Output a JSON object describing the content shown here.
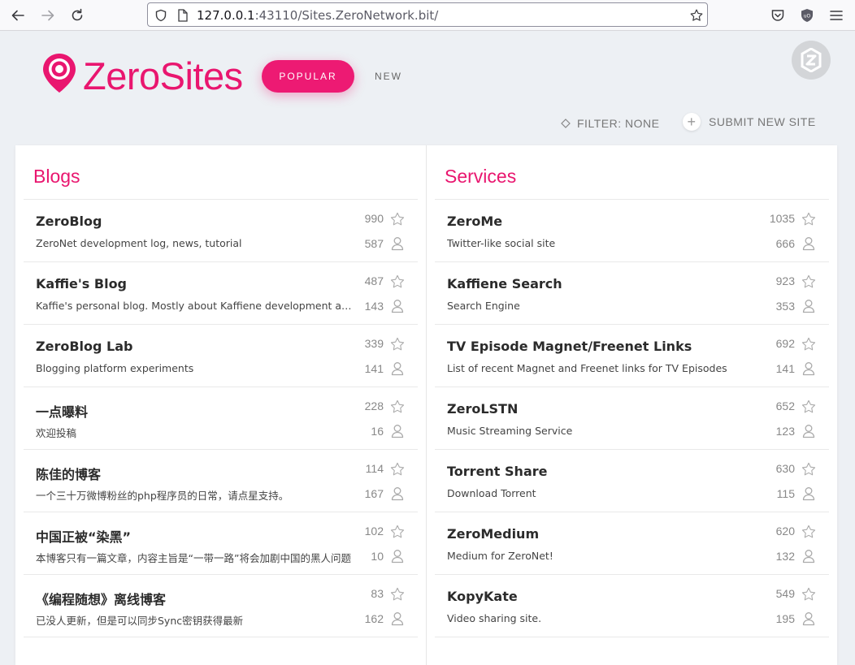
{
  "browser": {
    "url_host": "127.0.0.1",
    "url_rest": ":43110/Sites.ZeroNetwork.bit/"
  },
  "header": {
    "logo_text": "ZeroSites",
    "tabs": [
      {
        "label": "POPULAR",
        "active": true
      },
      {
        "label": "NEW",
        "active": false
      }
    ],
    "filter_label": "FILTER: NONE",
    "submit_label": "SUBMIT NEW SITE"
  },
  "colors": {
    "accent": "#e9166f",
    "background": "#edf0f4"
  },
  "categories": [
    {
      "title": "Blogs",
      "sites": [
        {
          "title": "ZeroBlog",
          "desc": "ZeroNet development log, news, tutorial",
          "stars": "990",
          "peers": "587"
        },
        {
          "title": "Kaffie's Blog",
          "desc": "Kaffie's personal blog. Mostly about Kaffiene development and other things",
          "stars": "487",
          "peers": "143"
        },
        {
          "title": "ZeroBlog Lab",
          "desc": "Blogging platform experiments",
          "stars": "339",
          "peers": "141"
        },
        {
          "title": "一点曝料",
          "desc": "欢迎投稿",
          "stars": "228",
          "peers": "16"
        },
        {
          "title": "陈佳的博客",
          "desc": "一个三十万微博粉丝的php程序员的日常，请点星支持。",
          "stars": "114",
          "peers": "167"
        },
        {
          "title": "中国正被“染黑”",
          "desc": "本博客只有一篇文章，内容主旨是“一带一路”将会加剧中国的黑人问题",
          "stars": "102",
          "peers": "10"
        },
        {
          "title": "《编程随想》离线博客",
          "desc": "已没人更新，但是可以同步Sync密钥获得最新",
          "stars": "83",
          "peers": "162"
        }
      ]
    },
    {
      "title": "Services",
      "sites": [
        {
          "title": "ZeroMe",
          "desc": "Twitter-like social site",
          "stars": "1035",
          "peers": "666"
        },
        {
          "title": "Kaffiene Search",
          "desc": "Search Engine",
          "stars": "923",
          "peers": "353"
        },
        {
          "title": "TV Episode Magnet/Freenet Links",
          "desc": "List of recent Magnet and Freenet links for TV Episodes",
          "stars": "692",
          "peers": "141"
        },
        {
          "title": "ZeroLSTN",
          "desc": "Music Streaming Service",
          "stars": "652",
          "peers": "123"
        },
        {
          "title": "Torrent Share",
          "desc": "Download Torrent",
          "stars": "630",
          "peers": "115"
        },
        {
          "title": "ZeroMedium",
          "desc": "Medium for ZeroNet!",
          "stars": "620",
          "peers": "132"
        },
        {
          "title": "KopyKate",
          "desc": "Video sharing site.",
          "stars": "549",
          "peers": "195"
        }
      ]
    }
  ]
}
